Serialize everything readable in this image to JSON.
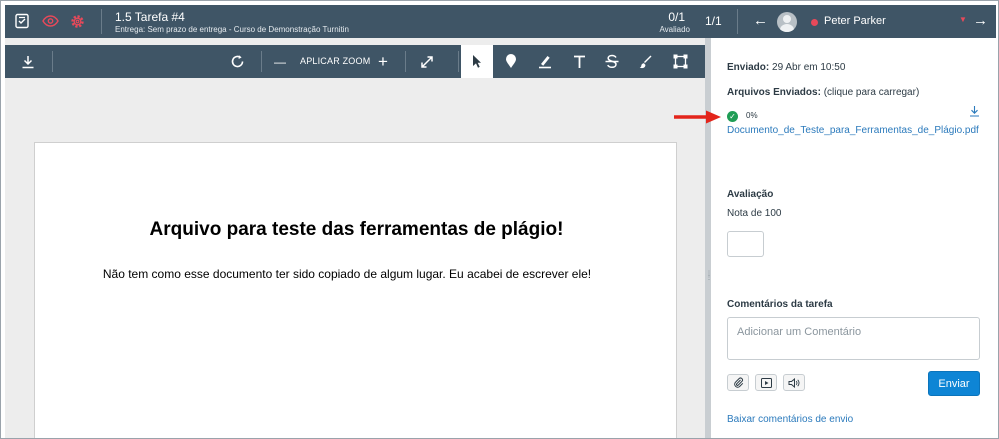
{
  "header": {
    "assignment_title": "1.5 Tarefa #4",
    "assignment_subtitle": "Entrega: Sem prazo de entrega - Curso de Demonstração Turnitin",
    "score": "0/1",
    "score_label": "Avaliado",
    "submission_count": "1/1",
    "prev_arrow": "←",
    "next_arrow": "→",
    "student_name": "Peter Parker",
    "caret": "▼"
  },
  "toolbar": {
    "zoom_label": "APLICAR ZOOM",
    "zoom_minus": "—",
    "zoom_plus": "+"
  },
  "document": {
    "title": "Arquivo para teste das ferramentas de plágio!",
    "body": "Não tem como esse documento ter sido copiado de algum lugar. Eu acabei de escrever ele!"
  },
  "panel": {
    "submitted_label": "Enviado:",
    "submitted_value": "29 Abr em 10:50",
    "files_label": "Arquivos Enviados:",
    "files_hint": "(clique para carregar)",
    "similarity": "0%",
    "file_name": "Documento_de_Teste_para_Ferramentas_de_Plágio.pdf",
    "grade_heading": "Avaliação",
    "grade_out_of": "Nota de 100",
    "grade_value": "",
    "comments_heading": "Comentários da tarefa",
    "comment_placeholder": "Adicionar um Comentário",
    "send_label": "Enviar",
    "download_comments": "Baixar comentários de envio"
  },
  "colors": {
    "header_bg": "#3f5566",
    "accent_blue": "#0e85d5",
    "link_blue": "#2b7abc",
    "status_red": "#e8495a",
    "success_green": "#1f9d55",
    "annotation_red": "#e3251b"
  },
  "icons": {
    "gradebook": "gradebook-icon",
    "preview": "eye-icon",
    "settings": "gear-icon",
    "download": "download-icon",
    "rotate": "rotate-icon",
    "expand": "expand-icon",
    "select": "pointer-icon",
    "point_annotation": "pin-icon",
    "highlight": "highlight-icon",
    "text": "text-icon",
    "strikeout": "strikethrough-icon",
    "freedraw": "brush-icon",
    "area": "area-icon"
  }
}
